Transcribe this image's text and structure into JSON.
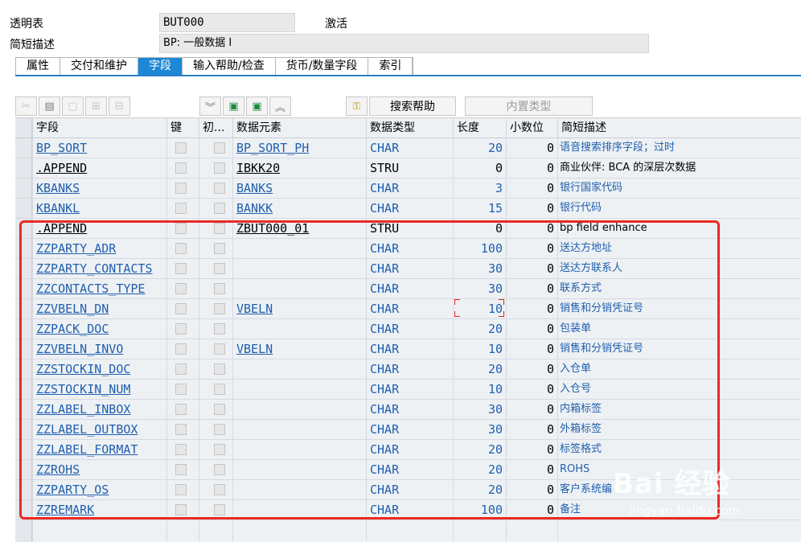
{
  "header": {
    "table_type_label": "透明表",
    "table_name": "BUT000",
    "status": "激活",
    "short_desc_label": "简短描述",
    "short_desc_value": "BP: 一般数据 I"
  },
  "tabs": [
    {
      "label": "属性",
      "active": false
    },
    {
      "label": "交付和维护",
      "active": false
    },
    {
      "label": "字段",
      "active": true
    },
    {
      "label": "输入帮助/检查",
      "active": false
    },
    {
      "label": "货币/数量字段",
      "active": false
    },
    {
      "label": "索引",
      "active": false
    }
  ],
  "toolbar": {
    "icons": [
      "cut-icon",
      "copy-icon",
      "paste-icon",
      "insert-row-icon",
      "delete-row-icon",
      "move-down-icon",
      "new-entry-icon",
      "detail-icon",
      "move-up-icon",
      "search-help-key-icon"
    ],
    "search_help_label": "搜索帮助",
    "builtin_type_label": "内置类型"
  },
  "columns": [
    "字段",
    "键",
    "初...",
    "数据元素",
    "数据类型",
    "长度",
    "小数位",
    "简短描述"
  ],
  "rows": [
    {
      "field": "BP_SORT",
      "data_element": "BP_SORT_PH",
      "type": "CHAR",
      "length": "20",
      "decimals": "0",
      "desc": "语音搜索排序字段；过时"
    },
    {
      "field": ".APPEND",
      "data_element": "IBKK20",
      "type": "STRU",
      "length": "0",
      "decimals": "0",
      "desc": "商业伙伴: BCA 的深层次数据"
    },
    {
      "field": "KBANKS",
      "data_element": "BANKS",
      "type": "CHAR",
      "length": "3",
      "decimals": "0",
      "desc": "银行国家代码"
    },
    {
      "field": "KBANKL",
      "data_element": "BANKK",
      "type": "CHAR",
      "length": "15",
      "decimals": "0",
      "desc": "银行代码"
    },
    {
      "field": ".APPEND",
      "data_element": "ZBUT000_01",
      "type": "STRU",
      "length": "0",
      "decimals": "0",
      "desc": "bp field enhance"
    },
    {
      "field": "ZZPARTY_ADR",
      "data_element": "",
      "type": "CHAR",
      "length": "100",
      "decimals": "0",
      "desc": "送达方地址"
    },
    {
      "field": "ZZPARTY_CONTACTS",
      "data_element": "",
      "type": "CHAR",
      "length": "30",
      "decimals": "0",
      "desc": "送达方联系人"
    },
    {
      "field": "ZZCONTACTS_TYPE",
      "data_element": "",
      "type": "CHAR",
      "length": "30",
      "decimals": "0",
      "desc": "联系方式"
    },
    {
      "field": "ZZVBELN_DN",
      "data_element": "VBELN",
      "type": "CHAR",
      "length": "10",
      "decimals": "0",
      "desc": "销售和分销凭证号"
    },
    {
      "field": "ZZPACK_DOC",
      "data_element": "",
      "type": "CHAR",
      "length": "20",
      "decimals": "0",
      "desc": "包装单"
    },
    {
      "field": "ZZVBELN_INVO",
      "data_element": "VBELN",
      "type": "CHAR",
      "length": "10",
      "decimals": "0",
      "desc": "销售和分销凭证号"
    },
    {
      "field": "ZZSTOCKIN_DOC",
      "data_element": "",
      "type": "CHAR",
      "length": "20",
      "decimals": "0",
      "desc": "入仓单"
    },
    {
      "field": "ZZSTOCKIN_NUM",
      "data_element": "",
      "type": "CHAR",
      "length": "10",
      "decimals": "0",
      "desc": "入仓号"
    },
    {
      "field": "ZZLABEL_INBOX",
      "data_element": "",
      "type": "CHAR",
      "length": "30",
      "decimals": "0",
      "desc": "内箱标签"
    },
    {
      "field": "ZZLABEL_OUTBOX",
      "data_element": "",
      "type": "CHAR",
      "length": "30",
      "decimals": "0",
      "desc": "外箱标签"
    },
    {
      "field": "ZZLABEL_FORMAT",
      "data_element": "",
      "type": "CHAR",
      "length": "20",
      "decimals": "0",
      "desc": "标签格式"
    },
    {
      "field": "ZZROHS",
      "data_element": "",
      "type": "CHAR",
      "length": "20",
      "decimals": "0",
      "desc": "ROHS"
    },
    {
      "field": "ZZPARTY_OS",
      "data_element": "",
      "type": "CHAR",
      "length": "20",
      "decimals": "0",
      "desc": "客户系统编"
    },
    {
      "field": "ZZREMARK",
      "data_element": "",
      "type": "CHAR",
      "length": "100",
      "decimals": "0",
      "desc": "备注"
    }
  ],
  "watermark": {
    "brand": "Bai 经验",
    "url": "jingyan.baidu.com"
  }
}
